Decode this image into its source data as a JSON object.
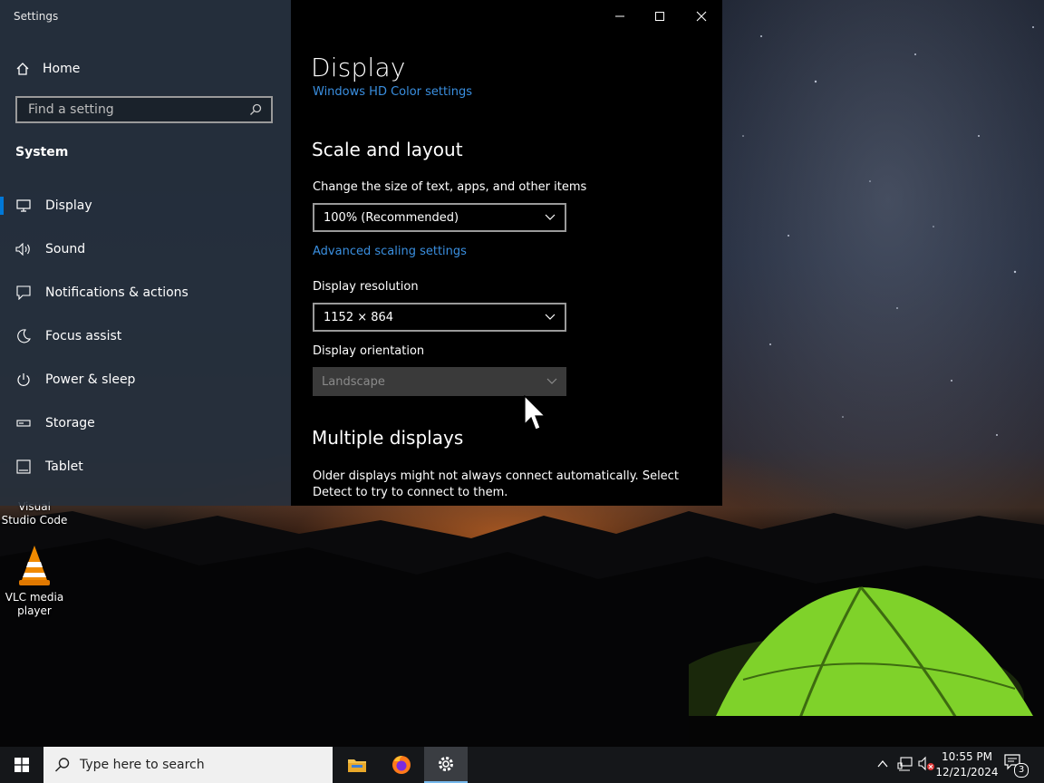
{
  "desktop": {
    "icons": [
      {
        "label": "Visual Studio Code"
      },
      {
        "label": "VLC media player"
      }
    ]
  },
  "settings": {
    "window_title": "Settings",
    "nav": {
      "home_label": "Home",
      "search_placeholder": "Find a setting",
      "section_label": "System",
      "items": [
        {
          "label": "Display",
          "icon": "monitor-icon",
          "active": true
        },
        {
          "label": "Sound",
          "icon": "speaker-icon"
        },
        {
          "label": "Notifications & actions",
          "icon": "notification-icon"
        },
        {
          "label": "Focus assist",
          "icon": "moon-icon"
        },
        {
          "label": "Power & sleep",
          "icon": "power-icon"
        },
        {
          "label": "Storage",
          "icon": "storage-icon"
        },
        {
          "label": "Tablet",
          "icon": "tablet-icon"
        }
      ]
    },
    "content": {
      "page_title": "Display",
      "hd_color_link": "Windows HD Color settings",
      "scale_heading": "Scale and layout",
      "scale_label": "Change the size of text, apps, and other items",
      "scale_value": "100% (Recommended)",
      "advanced_scaling_link": "Advanced scaling settings",
      "resolution_label": "Display resolution",
      "resolution_value": "1152 × 864",
      "orientation_label": "Display orientation",
      "orientation_value": "Landscape",
      "multiple_heading": "Multiple displays",
      "multiple_text": "Older displays might not always connect automatically. Select Detect to try to connect to them."
    }
  },
  "taskbar": {
    "search_placeholder": "Type here to search",
    "time": "10:55 PM",
    "date": "12/21/2024",
    "notification_count": "3"
  },
  "colors": {
    "accent": "#0078d7",
    "link": "#3a8fe0"
  }
}
